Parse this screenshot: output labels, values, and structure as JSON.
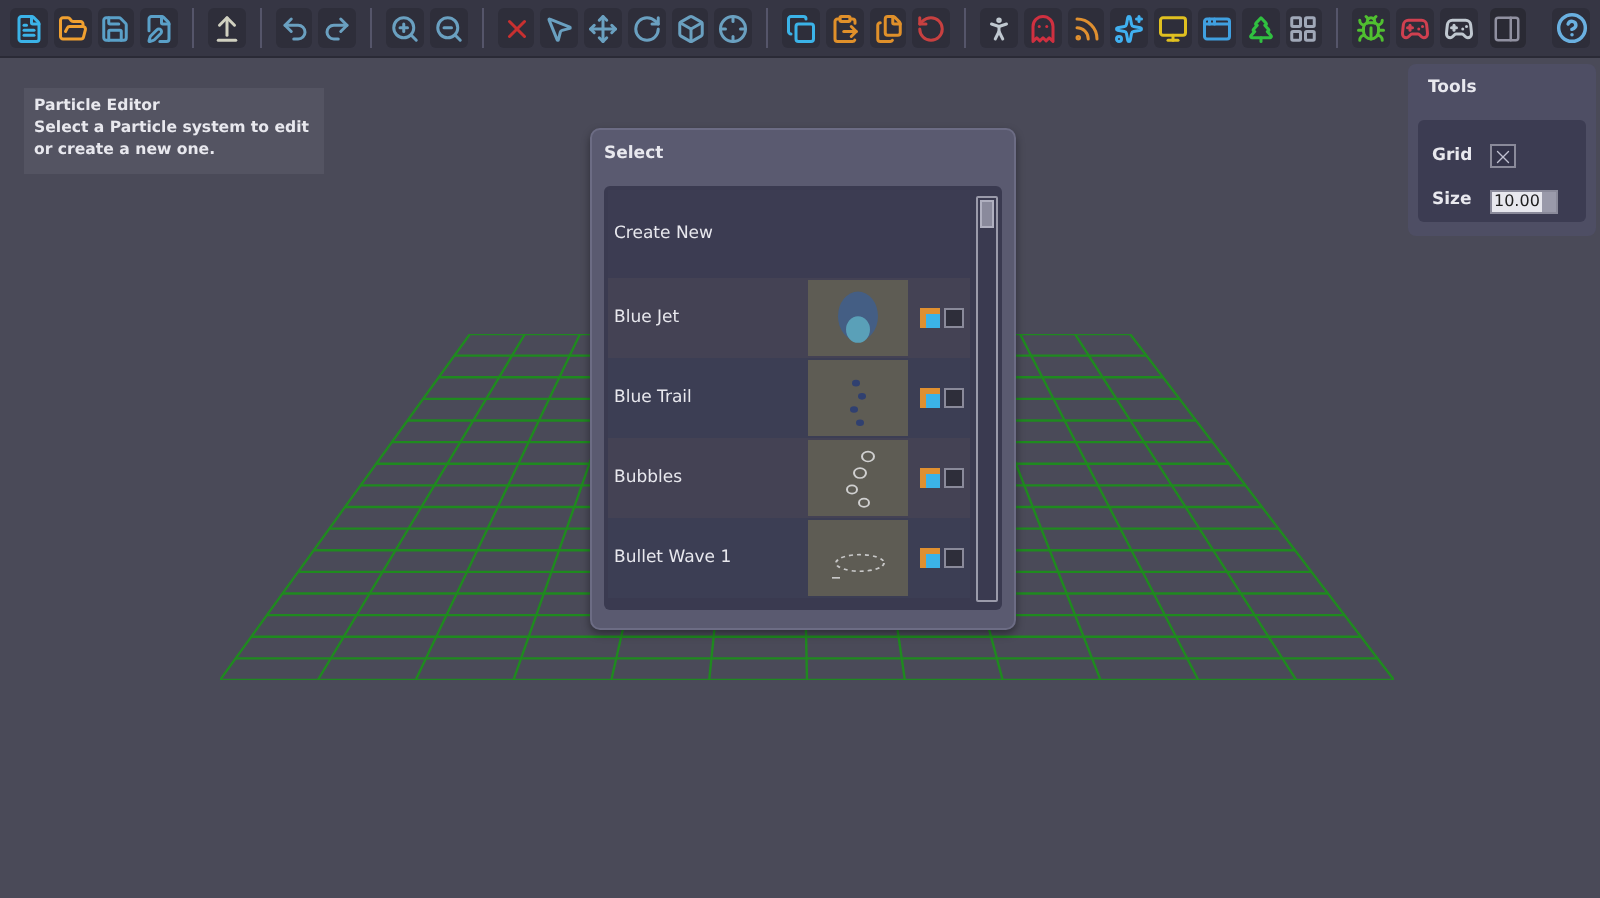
{
  "info": {
    "title": "Particle Editor",
    "text": "Select a Particle system to edit or create a new one."
  },
  "select": {
    "title": "Select",
    "items": [
      {
        "kind": "create",
        "name": "Create New"
      },
      {
        "kind": "system",
        "name": "Blue Jet",
        "checked": false
      },
      {
        "kind": "system",
        "name": "Blue Trail",
        "checked": false
      },
      {
        "kind": "system",
        "name": "Bubbles",
        "checked": false
      },
      {
        "kind": "system",
        "name": "Bullet Wave 1",
        "checked": false
      }
    ]
  },
  "tools": {
    "title": "Tools",
    "grid_label": "Grid",
    "grid_checked": true,
    "size_label": "Size",
    "size_value": "10.00"
  }
}
